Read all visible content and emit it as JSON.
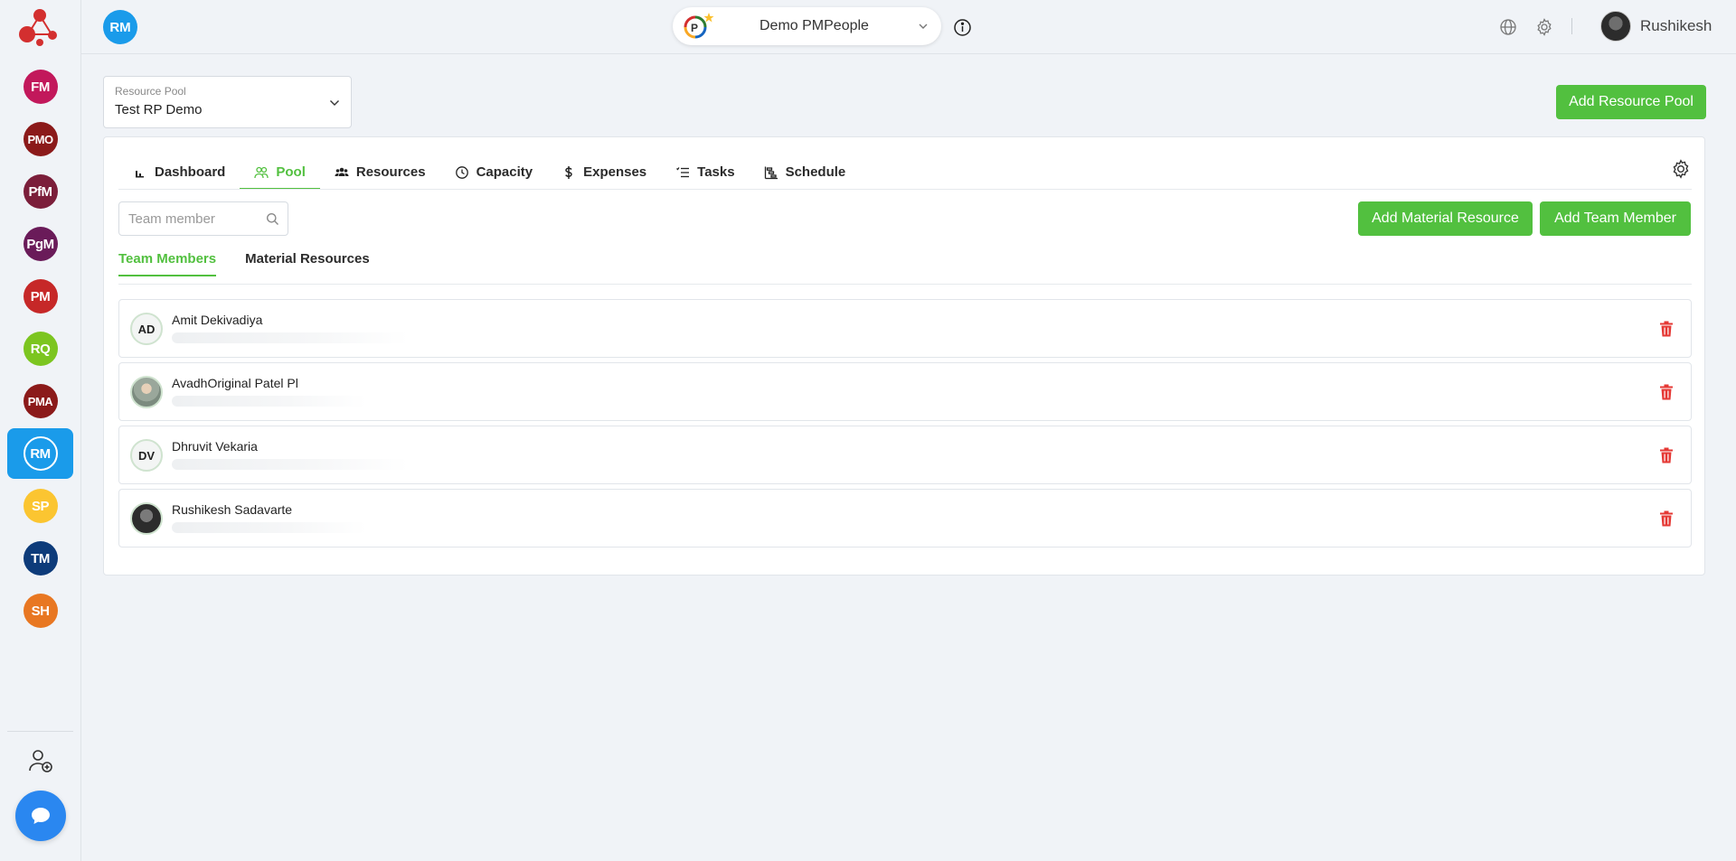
{
  "sidebar": {
    "items": [
      {
        "label": "FM",
        "color": "#c2185b"
      },
      {
        "label": "PMO",
        "color": "#8b1a1a"
      },
      {
        "label": "PfM",
        "color": "#7b1e3a"
      },
      {
        "label": "PgM",
        "color": "#6a1b59"
      },
      {
        "label": "PM",
        "color": "#c62828"
      },
      {
        "label": "RQ",
        "color": "#7cc520"
      },
      {
        "label": "PMA",
        "color": "#8b1a1a"
      },
      {
        "label": "RM",
        "color": "#1a9bea",
        "active": true
      },
      {
        "label": "SP",
        "color": "#fbc531"
      },
      {
        "label": "TM",
        "color": "#0d3b7a"
      },
      {
        "label": "SH",
        "color": "#e87722"
      }
    ]
  },
  "header": {
    "module_badge": "RM",
    "workspace": "Demo PMPeople",
    "username": "Rushikesh"
  },
  "resource_pool": {
    "label": "Resource Pool",
    "value": "Test RP Demo",
    "add_button": "Add Resource Pool"
  },
  "tabs": [
    {
      "label": "Dashboard",
      "icon": "bar-chart-icon"
    },
    {
      "label": "Pool",
      "icon": "people-icon",
      "active": true
    },
    {
      "label": "Resources",
      "icon": "group-icon"
    },
    {
      "label": "Capacity",
      "icon": "clock-icon"
    },
    {
      "label": "Expenses",
      "icon": "dollar-icon"
    },
    {
      "label": "Tasks",
      "icon": "list-icon"
    },
    {
      "label": "Schedule",
      "icon": "gantt-icon"
    }
  ],
  "search": {
    "placeholder": "Team member"
  },
  "actions": {
    "add_material": "Add Material Resource",
    "add_member": "Add Team Member"
  },
  "subtabs": [
    {
      "label": "Team Members",
      "active": true
    },
    {
      "label": "Material Resources"
    }
  ],
  "members": [
    {
      "name": "Amit Dekivadiya",
      "initials": "AD"
    },
    {
      "name": "AvadhOriginal Patel Pl",
      "initials": ""
    },
    {
      "name": "Dhruvit Vekaria",
      "initials": "DV"
    },
    {
      "name": "Rushikesh Sadavarte",
      "initials": ""
    }
  ],
  "colors": {
    "accent": "#52c03f",
    "primary": "#1a9bea",
    "danger": "#e53935"
  }
}
